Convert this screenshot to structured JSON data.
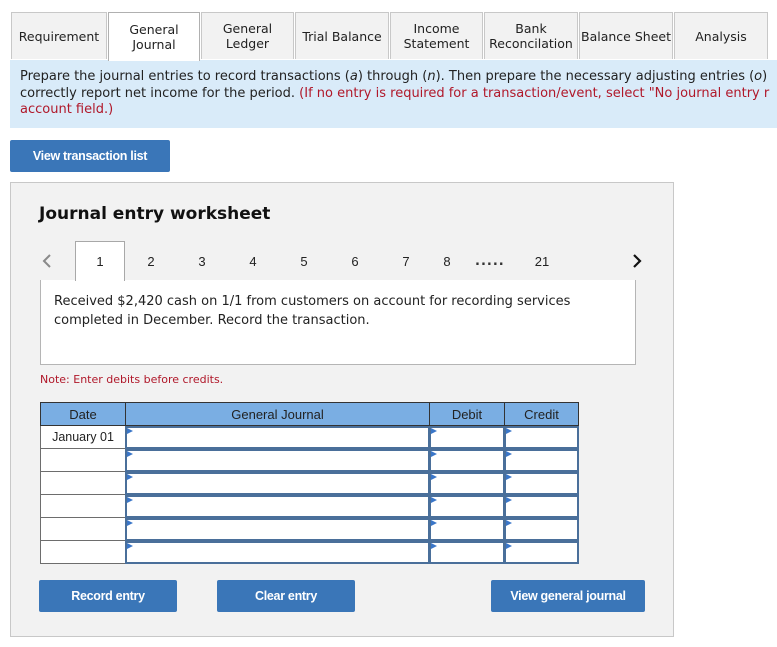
{
  "tabs": [
    {
      "label": "Requirement",
      "active": false
    },
    {
      "label": "General Journal",
      "active": true
    },
    {
      "label": "General Ledger",
      "active": false
    },
    {
      "label": "Trial Balance",
      "active": false
    },
    {
      "label": "Income Statement",
      "active": false
    },
    {
      "label": "Bank Reconcilation",
      "active": false
    },
    {
      "label": "Balance Sheet",
      "active": false
    },
    {
      "label": "Analysis",
      "active": false
    }
  ],
  "instructions": {
    "line1": "Prepare the journal entries to record transactions (a) through (n). Then prepare the necessary adjusting entries (o)",
    "line2_plain": "correctly report net income for the period. ",
    "line2_red": "(If no entry is required for a transaction/event, select \"No journal entry r",
    "line3_red": "account field.)"
  },
  "view_transaction_list_label": "View transaction list",
  "worksheet": {
    "title": "Journal entry worksheet",
    "pager": {
      "prev_icon": "chevron-left-icon",
      "next_icon": "chevron-right-icon",
      "pages": [
        "1",
        "2",
        "3",
        "4",
        "5",
        "6",
        "7",
        "8"
      ],
      "ellipsis": ".....",
      "last_page": "21",
      "active_page": "1"
    },
    "description": "Received $2,420 cash on 1/1 from customers on account for recording services completed in December. Record the transaction.",
    "note": "Note: Enter debits before credits.",
    "table": {
      "headers": {
        "date": "Date",
        "journal": "General Journal",
        "debit": "Debit",
        "credit": "Credit"
      },
      "rows": [
        {
          "date": "January 01",
          "account": "",
          "debit": "",
          "credit": ""
        },
        {
          "date": "",
          "account": "",
          "debit": "",
          "credit": ""
        },
        {
          "date": "",
          "account": "",
          "debit": "",
          "credit": ""
        },
        {
          "date": "",
          "account": "",
          "debit": "",
          "credit": ""
        },
        {
          "date": "",
          "account": "",
          "debit": "",
          "credit": ""
        },
        {
          "date": "",
          "account": "",
          "debit": "",
          "credit": ""
        }
      ]
    },
    "buttons": {
      "record": "Record entry",
      "clear": "Clear entry",
      "view_journal": "View general journal"
    }
  },
  "colors": {
    "button_blue": "#3a76b8",
    "header_blue": "#7aaee3",
    "instruction_bg": "#d9ebf9",
    "note_red": "#b0182a"
  }
}
